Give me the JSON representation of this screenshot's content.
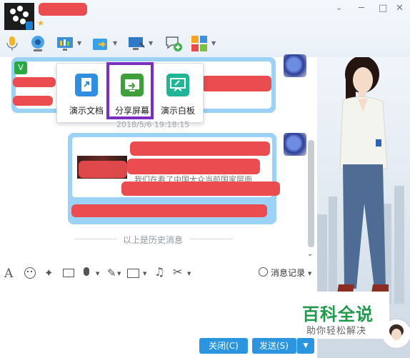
{
  "window": {
    "minimize": "─",
    "maximize": "□",
    "close": "✕",
    "expand": "⌄",
    "star": "★"
  },
  "popup": {
    "items": [
      {
        "label": "演示文档"
      },
      {
        "label": "分享屏幕"
      },
      {
        "label": "演示白板"
      }
    ],
    "highlight_color": "#7b2fbf"
  },
  "chat": {
    "timestamp": "2018/5/6 19:18:15",
    "partial_text": "我们在看了中国大众当前国家层面",
    "history_label": "以上是历史消息"
  },
  "input_toolbar": {
    "history_button": "消息记录"
  },
  "buttons": {
    "close": "关闭(C)",
    "send": "发送(S)"
  },
  "watermark": {
    "title": "百科全说",
    "subtitle": "助你轻松解决"
  },
  "colors": {
    "accent": "#2b95e0",
    "bubble": "#9bd2f5",
    "redaction": "#ea4c4f",
    "watermark_green": "#1f9a4b"
  }
}
